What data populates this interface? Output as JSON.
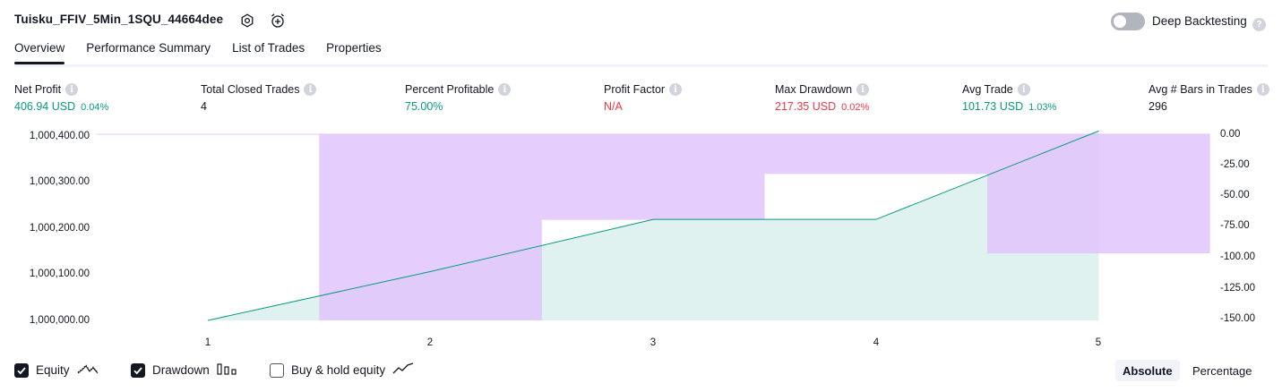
{
  "header": {
    "strategy_title": "Tuisku_FFIV_5Min_1SQU_44664dee",
    "settings_icon": "settings-icon",
    "alert_icon": "alarm-add-icon",
    "deep_backtesting_label": "Deep Backtesting",
    "deep_backtesting_on": false,
    "help_mark": "?"
  },
  "tabs": [
    {
      "label": "Overview",
      "active": true
    },
    {
      "label": "Performance Summary",
      "active": false
    },
    {
      "label": "List of Trades",
      "active": false
    },
    {
      "label": "Properties",
      "active": false
    }
  ],
  "metrics": [
    {
      "label": "Net Profit",
      "value": "406.94 USD",
      "pct": "0.04%",
      "color": "#089981"
    },
    {
      "label": "Total Closed Trades",
      "value": "4",
      "pct": "",
      "color": "#131722"
    },
    {
      "label": "Percent Profitable",
      "value": "75.00%",
      "pct": "",
      "color": "#089981"
    },
    {
      "label": "Profit Factor",
      "value": "N/A",
      "pct": "",
      "color": "#f23645"
    },
    {
      "label": "Max Drawdown",
      "value": "217.35 USD",
      "pct": "0.02%",
      "color": "#f23645"
    },
    {
      "label": "Avg Trade",
      "value": "101.73 USD",
      "pct": "1.03%",
      "color": "#089981"
    },
    {
      "label": "Avg # Bars in Trades",
      "value": "296",
      "pct": "",
      "color": "#131722"
    }
  ],
  "info_mark": "i",
  "chart_data": {
    "type": "area",
    "x_ticks": [
      "1",
      "2",
      "3",
      "4",
      "5"
    ],
    "left_axis": {
      "ticks": [
        "1,000,400.00",
        "1,000,300.00",
        "1,000,200.00",
        "1,000,100.00",
        "1,000,000.00"
      ],
      "ylim": [
        1000000,
        1000400
      ]
    },
    "right_axis": {
      "ticks": [
        "0.00",
        "-25.00",
        "-50.00",
        "-75.00",
        "-100.00",
        "-125.00",
        "-150.00"
      ],
      "ylim": [
        -150,
        0
      ]
    },
    "series": [
      {
        "name": "Equity",
        "type": "line",
        "x": [
          1,
          2,
          3,
          4,
          5
        ],
        "values": [
          1000000,
          1000105,
          1000217,
          1000217,
          1000407
        ],
        "color": "#089981"
      },
      {
        "name": "Drawdown",
        "type": "bar",
        "x": [
          2,
          3,
          4,
          5
        ],
        "values": [
          -150,
          -69,
          -32,
          -96
        ],
        "color": "#e1c4fd"
      }
    ],
    "grid": false
  },
  "legend": [
    {
      "label": "Equity",
      "checked": true,
      "icon": "equity-line-icon"
    },
    {
      "label": "Drawdown",
      "checked": true,
      "icon": "drawdown-bars-icon"
    },
    {
      "label": "Buy & hold equity",
      "checked": false,
      "icon": "buy-hold-line-icon"
    }
  ],
  "view_mode": {
    "options": [
      "Absolute",
      "Percentage"
    ],
    "selected": "Absolute"
  }
}
